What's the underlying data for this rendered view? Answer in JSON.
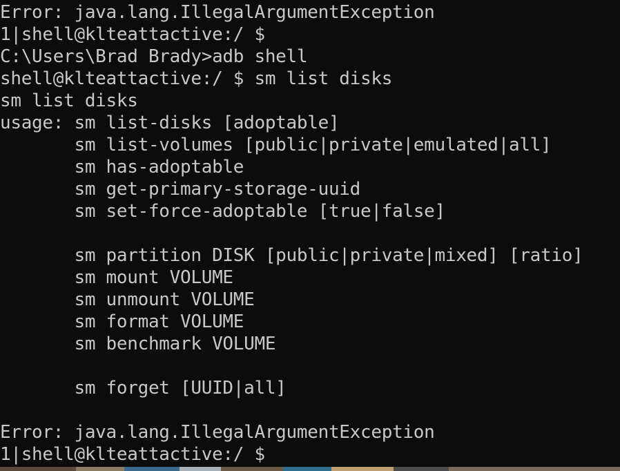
{
  "terminal": {
    "lines": [
      "Error: java.lang.IllegalArgumentException",
      "1|shell@klteattactive:/ $",
      "C:\\Users\\Brad Brady>adb shell",
      "shell@klteattactive:/ $ sm list disks",
      "sm list disks",
      "usage: sm list-disks [adoptable]",
      "       sm list-volumes [public|private|emulated|all]",
      "       sm has-adoptable",
      "       sm get-primary-storage-uuid",
      "       sm set-force-adoptable [true|false]",
      "",
      "       sm partition DISK [public|private|mixed] [ratio]",
      "       sm mount VOLUME",
      "       sm unmount VOLUME",
      "       sm format VOLUME",
      "       sm benchmark VOLUME",
      "",
      "       sm forget [UUID|all]",
      "",
      "Error: java.lang.IllegalArgumentException",
      "1|shell@klteattactive:/ $"
    ]
  },
  "colors": {
    "background": "#0c0c0c",
    "text": "#c8c8c8"
  }
}
